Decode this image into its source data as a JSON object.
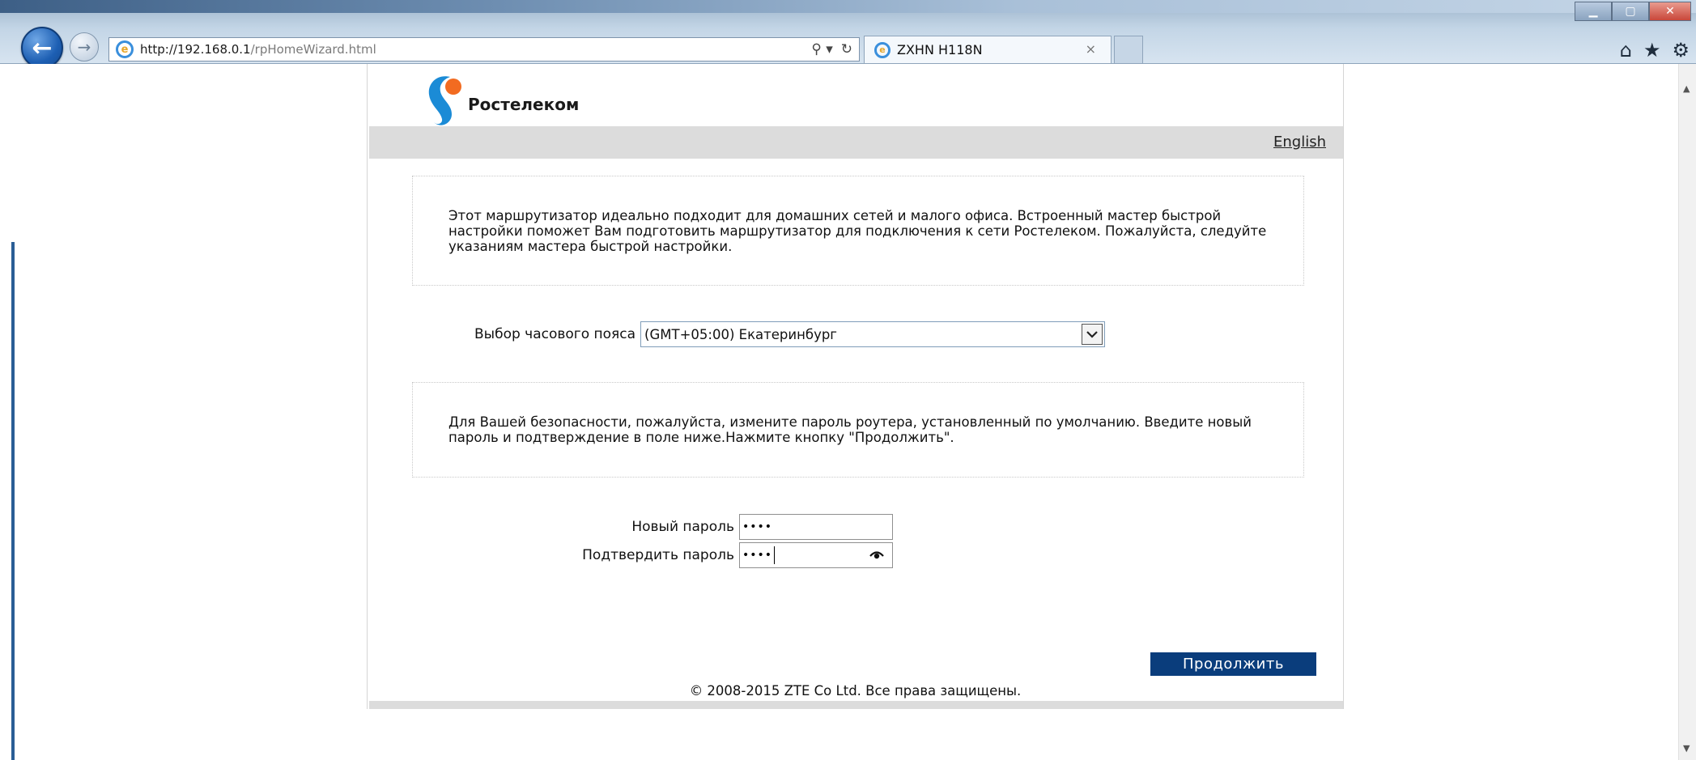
{
  "browser": {
    "address_host": "http://192.168.0.1",
    "address_path": "/rpHomeWizard.html",
    "tab_title": "ZXHN H118N",
    "tab_close": "×",
    "search_glyph": "⚲ ▾",
    "refresh_glyph": "↻"
  },
  "router_page": {
    "brand": "Ростелеком",
    "language_link": "English",
    "intro_text": "Этот маршрутизатор идеально подходит для домашних сетей и малого офиса. Встроенный мастер быстрой настройки поможет Вам подготовить маршрутизатор для подключения к сети Ростелеком. Пожалуйста, следуйте указаниям мастера быстрой настройки.",
    "timezone_label": "Выбор часового пояса",
    "timezone_value": "(GMT+05:00) Екатеринбург",
    "security_text": "Для Вашей безопасности, пожалуйста, измените пароль роутера, установленный по умолчанию. Введите новый пароль и подтверждение в поле ниже.Нажмите кнопку \"Продолжить\".",
    "new_password_label": "Новый пароль",
    "new_password_value": "••••",
    "confirm_password_label": "Подтвердить пароль",
    "confirm_password_value": "••••",
    "continue_button": "Продолжить",
    "copyright": "© 2008-2015 ZTE Co Ltd. Все права защищены."
  },
  "colors": {
    "button_bg": "#0a3d7c",
    "lang_bar_bg": "#dcdcdc",
    "logo_blue": "#1b8bd6",
    "logo_orange": "#f26b21"
  }
}
